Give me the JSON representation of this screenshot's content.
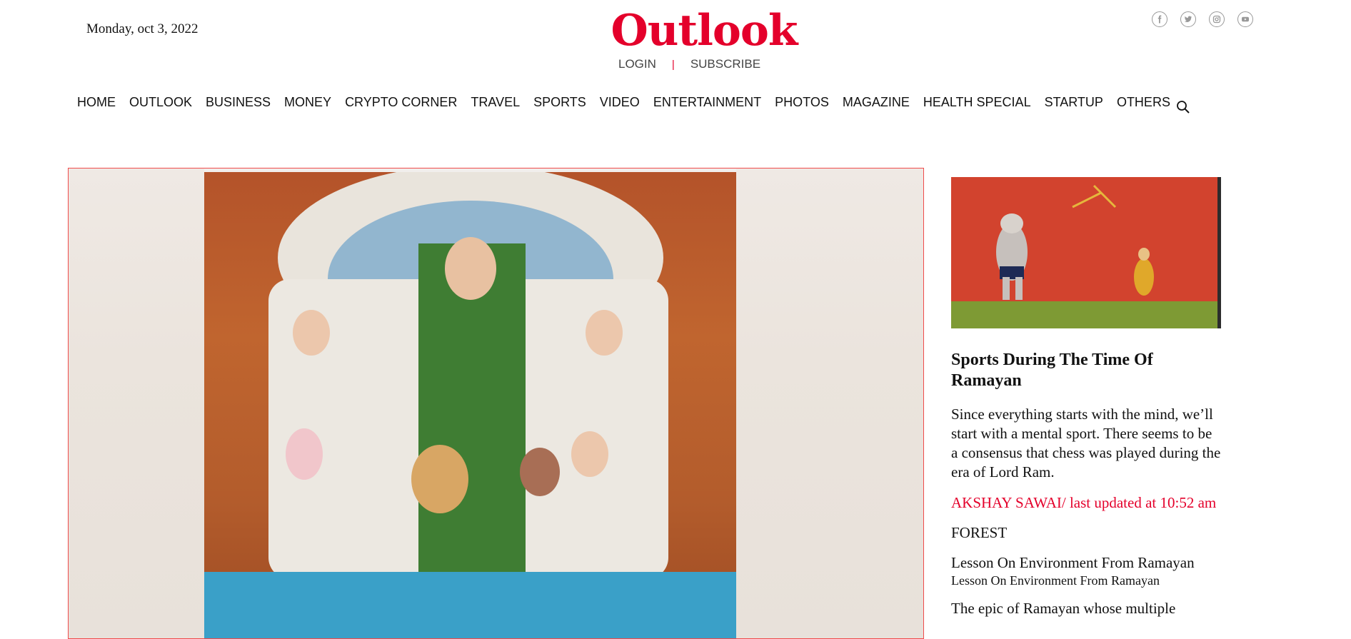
{
  "header": {
    "date": "Monday, oct 3, 2022",
    "logo": "Outlook",
    "login": "LOGIN",
    "separator": "|",
    "subscribe": "SUBSCRIBE",
    "brand_color": "#e4002b",
    "social_icons": [
      "facebook-icon",
      "twitter-icon",
      "instagram-icon",
      "youtube-icon"
    ]
  },
  "nav": {
    "items": [
      "HOME",
      "OUTLOOK",
      "BUSINESS",
      "MONEY",
      "CRYPTO CORNER",
      "TRAVEL",
      "SPORTS",
      "VIDEO",
      "ENTERTAINMENT",
      "PHOTOS",
      "MAGAZINE",
      "HEALTH SPECIAL",
      "STARTUP",
      "OTHERS"
    ],
    "search_icon": "search-icon"
  },
  "sidebar": {
    "title": "Sports During The Time Of Ramayan",
    "summary": "Since everything starts with the mind, we’ll start with a mental sport. There seems to be a consensus that chess was played during the era of Lord Ram.",
    "author_line": "AKSHAY SAWAI/ last updated at 10:52 am",
    "category": "FOREST",
    "story_title": "Lesson On Environment From Ramayan",
    "story_subtitle": "Lesson On Environment From Ramayan",
    "story_text": "The epic of Ramayan whose multiple"
  }
}
